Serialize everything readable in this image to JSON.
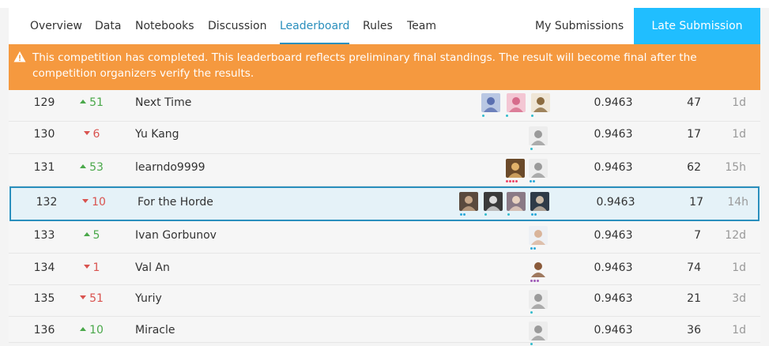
{
  "nav": {
    "tabs": [
      "Overview",
      "Data",
      "Notebooks",
      "Discussion",
      "Leaderboard",
      "Rules",
      "Team"
    ],
    "active_tab": "Leaderboard",
    "my_submissions": "My Submissions",
    "late_submission": "Late Submission"
  },
  "banner": {
    "text": "This competition has completed. This leaderboard reflects preliminary final standings. The result will become final after the competition organizers verify the results."
  },
  "colors": {
    "accent": "#20beff",
    "tab_active": "#2a8fbd",
    "banner": "#f5993f",
    "up": "#4aa84a",
    "down": "#d9534f"
  },
  "rows": [
    {
      "rank": "129",
      "delta": "51",
      "dir": "up",
      "team": "Next Time",
      "score": "0.9463",
      "entries": "47",
      "last": "1d"
    },
    {
      "rank": "130",
      "delta": "6",
      "dir": "down",
      "team": "Yu Kang",
      "score": "0.9463",
      "entries": "17",
      "last": "1d"
    },
    {
      "rank": "131",
      "delta": "53",
      "dir": "up",
      "team": "learndo9999",
      "score": "0.9463",
      "entries": "62",
      "last": "15h"
    },
    {
      "rank": "132",
      "delta": "10",
      "dir": "down",
      "team": "For the Horde",
      "score": "0.9463",
      "entries": "17",
      "last": "14h"
    },
    {
      "rank": "133",
      "delta": "5",
      "dir": "up",
      "team": "Ivan Gorbunov",
      "score": "0.9463",
      "entries": "7",
      "last": "12d"
    },
    {
      "rank": "134",
      "delta": "1",
      "dir": "down",
      "team": "Val An",
      "score": "0.9463",
      "entries": "74",
      "last": "1d"
    },
    {
      "rank": "135",
      "delta": "51",
      "dir": "down",
      "team": "Yuriy",
      "score": "0.9463",
      "entries": "21",
      "last": "3d"
    },
    {
      "rank": "136",
      "delta": "10",
      "dir": "up",
      "team": "Miracle",
      "score": "0.9463",
      "entries": "36",
      "last": "1d"
    }
  ]
}
